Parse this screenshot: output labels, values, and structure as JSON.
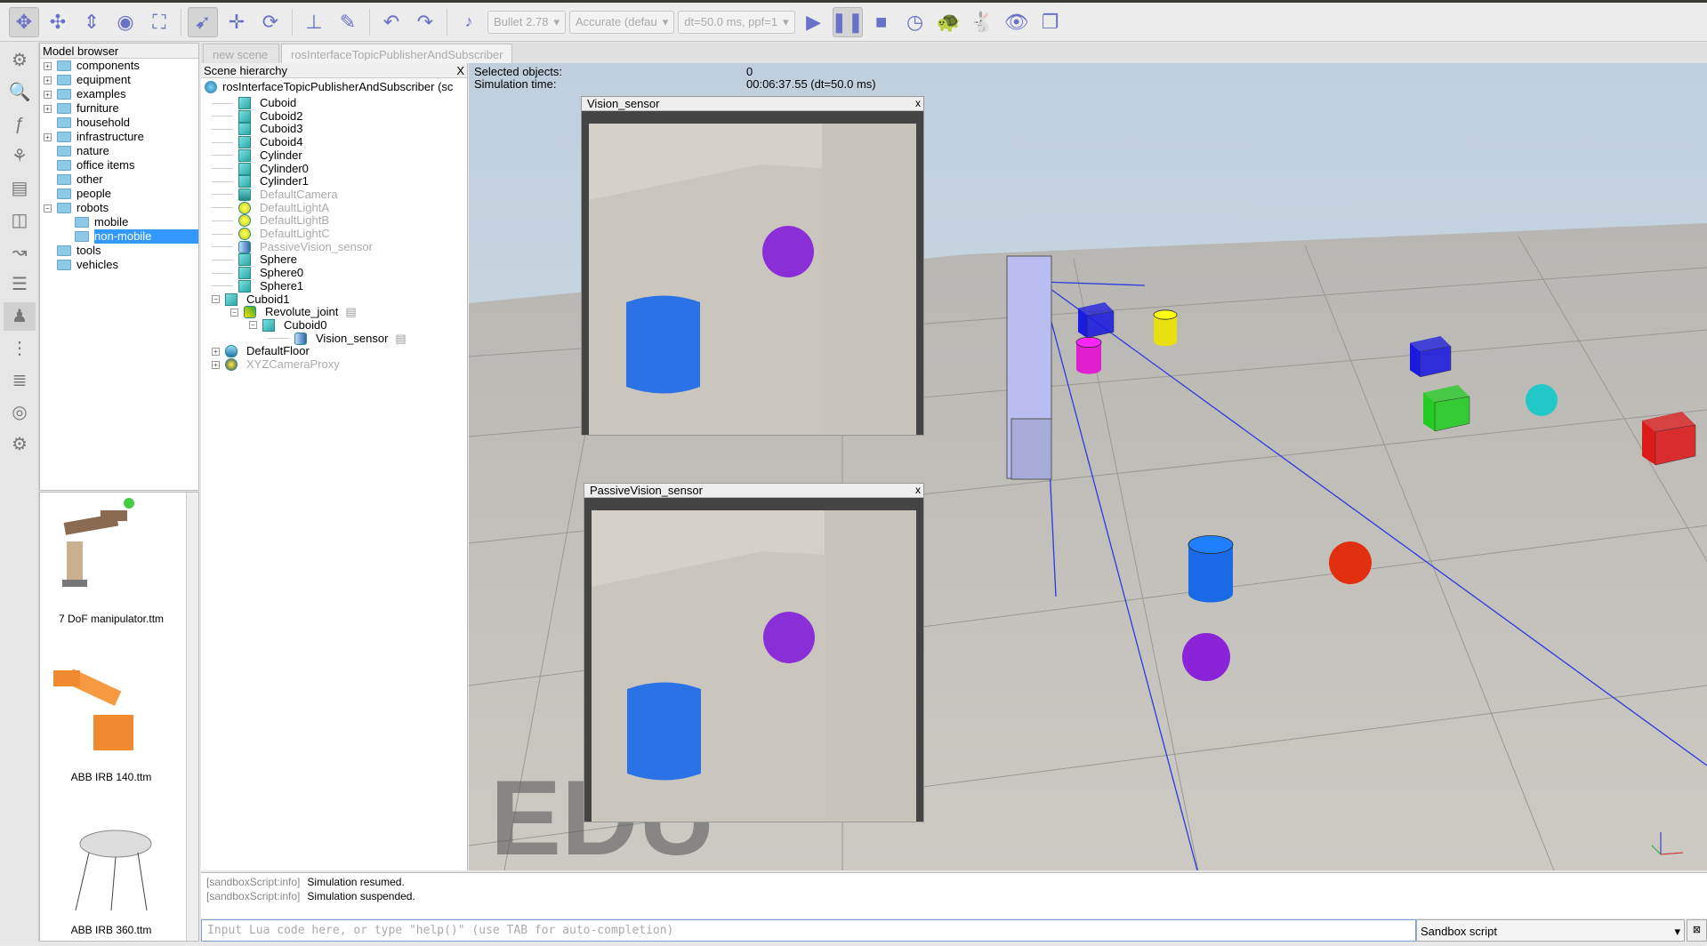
{
  "toolbar": {
    "icons": [
      "camera-pan-icon",
      "camera-rotate-icon",
      "camera-shift-icon",
      "camera-angle-icon",
      "fit-to-view-icon",
      "click-select-icon",
      "object-shift-icon",
      "object-rotate-icon",
      "assemble-icon",
      "transfer-dna-icon",
      "undo-icon",
      "redo-icon",
      "dynamics-toggle-icon",
      "play-icon",
      "pause-icon",
      "stop-icon",
      "realtime-icon",
      "slower-icon",
      "faster-icon",
      "thread-render-icon",
      "scene-selector-icon"
    ],
    "engine": "Bullet 2.78",
    "accuracy": "Accurate (defau",
    "timestep": "dt=50.0 ms, ppf=1"
  },
  "left_strip": {
    "icons": [
      "simulation-settings-icon",
      "zoom-icon",
      "calculation-modules-icon",
      "collections-icon",
      "scripts-icon",
      "shapes-icon",
      "paths-icon",
      "layers-icon",
      "model-browser-icon",
      "scene-hierarchy-icon",
      "layers-toggle-icon",
      "video-recorder-icon",
      "user-settings-icon"
    ]
  },
  "model_browser": {
    "title": "Model browser",
    "items": [
      {
        "label": "components",
        "expander": "+"
      },
      {
        "label": "equipment",
        "expander": "+"
      },
      {
        "label": "examples",
        "expander": "+"
      },
      {
        "label": "furniture",
        "expander": "+"
      },
      {
        "label": "household",
        "expander": ""
      },
      {
        "label": "infrastructure",
        "expander": "+"
      },
      {
        "label": "nature",
        "expander": ""
      },
      {
        "label": "office items",
        "expander": ""
      },
      {
        "label": "other",
        "expander": ""
      },
      {
        "label": "people",
        "expander": ""
      },
      {
        "label": "robots",
        "expander": "−"
      },
      {
        "label": "mobile",
        "expander": "",
        "child": true
      },
      {
        "label": "non-mobile",
        "expander": "",
        "child": true,
        "selected": true
      },
      {
        "label": "tools",
        "expander": ""
      },
      {
        "label": "vehicles",
        "expander": ""
      }
    ],
    "thumbnails": [
      "7 DoF manipulator.ttm",
      "ABB IRB 140.ttm",
      "ABB IRB 360.ttm"
    ]
  },
  "tabs": [
    "new scene",
    "rosInterfaceTopicPublisherAndSubscriber"
  ],
  "scene_hierarchy": {
    "title": "Scene hierarchy",
    "close": "X",
    "root": "rosInterfaceTopicPublisherAndSubscriber (sc",
    "items": [
      {
        "label": "Cuboid",
        "icon": "shape-icon",
        "depth": 0
      },
      {
        "label": "Cuboid2",
        "icon": "shape-icon",
        "depth": 0
      },
      {
        "label": "Cuboid3",
        "icon": "shape-icon",
        "depth": 0
      },
      {
        "label": "Cuboid4",
        "icon": "shape-icon",
        "depth": 0
      },
      {
        "label": "Cylinder",
        "icon": "shape-icon",
        "depth": 0
      },
      {
        "label": "Cylinder0",
        "icon": "shape-icon",
        "depth": 0
      },
      {
        "label": "Cylinder1",
        "icon": "shape-icon",
        "depth": 0
      },
      {
        "label": "DefaultCamera",
        "icon": "camera-icon",
        "depth": 0,
        "dim": true
      },
      {
        "label": "DefaultLightA",
        "icon": "light-icon",
        "depth": 0,
        "dim": true
      },
      {
        "label": "DefaultLightB",
        "icon": "light-icon",
        "depth": 0,
        "dim": true
      },
      {
        "label": "DefaultLightC",
        "icon": "light-icon",
        "depth": 0,
        "dim": true
      },
      {
        "label": "PassiveVision_sensor",
        "icon": "vision-sensor-icon",
        "depth": 0,
        "dim": true
      },
      {
        "label": "Sphere",
        "icon": "shape-icon",
        "depth": 0
      },
      {
        "label": "Sphere0",
        "icon": "shape-icon",
        "depth": 0
      },
      {
        "label": "Sphere1",
        "icon": "shape-icon",
        "depth": 0
      },
      {
        "label": "Cuboid1",
        "icon": "shape-icon",
        "depth": 0,
        "expander": "−"
      },
      {
        "label": "Revolute_joint",
        "icon": "joint-icon",
        "depth": 1,
        "expander": "−",
        "script": true
      },
      {
        "label": "Cuboid0",
        "icon": "shape-icon",
        "depth": 2,
        "expander": "−"
      },
      {
        "label": "Vision_sensor",
        "icon": "vision-sensor-icon",
        "depth": 3,
        "script": true
      },
      {
        "label": "DefaultFloor",
        "icon": "floor-icon",
        "depth": 0,
        "expander": "+"
      },
      {
        "label": "XYZCameraProxy",
        "icon": "camera-proxy-icon",
        "depth": 0,
        "expander": "+",
        "dim": true
      }
    ]
  },
  "info": {
    "selected_label": "Selected objects:",
    "selected_value": "0",
    "time_label": "Simulation time:",
    "time_value": "00:06:37.55 (dt=50.0 ms)"
  },
  "sensors": [
    {
      "title": "Vision_sensor",
      "close": "x"
    },
    {
      "title": "PassiveVision_sensor",
      "close": "x"
    }
  ],
  "watermark": "EDU",
  "console": {
    "lines": [
      {
        "tag": "[sandboxScript:info]",
        "msg": "Simulation resumed."
      },
      {
        "tag": "[sandboxScript:info]",
        "msg": "Simulation suspended."
      }
    ],
    "placeholder": "Input Lua code here, or type \"help()\" (use TAB for auto-completion)",
    "script_select": "Sandbox script"
  },
  "colors": {
    "accent": "#3399ff",
    "toolbar_icon": "#6a72c8",
    "sky": "#c7d6e3",
    "floor": "#c9c6c0"
  }
}
